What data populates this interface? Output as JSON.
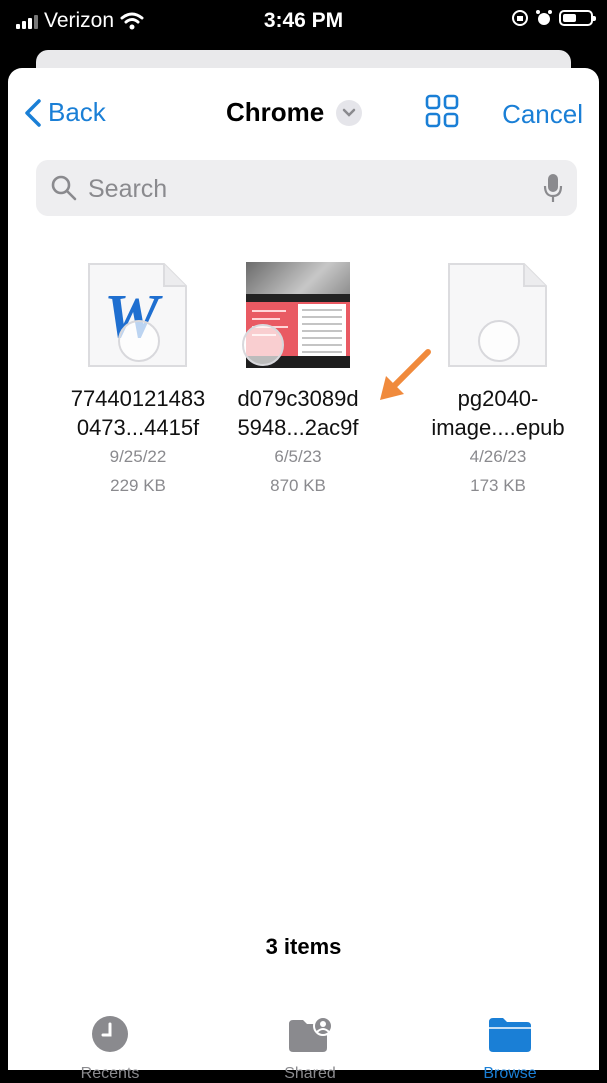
{
  "status_bar": {
    "carrier": "Verizon",
    "time": "3:46 PM"
  },
  "nav": {
    "back_label": "Back",
    "title": "Chrome",
    "cancel_label": "Cancel"
  },
  "search": {
    "placeholder": "Search"
  },
  "files": [
    {
      "name_line1": "77440121483",
      "name_line2": "0473...4415f",
      "date": "9/25/22",
      "size": "229 KB",
      "icon": "word-document-icon"
    },
    {
      "name_line1": "d079c3089d",
      "name_line2": "5948...2ac9f",
      "date": "6/5/23",
      "size": "870 KB",
      "icon": "image-thumbnail"
    },
    {
      "name_line1": "pg2040-",
      "name_line2": "image....epub",
      "date": "4/26/23",
      "size": "173 KB",
      "icon": "blank-document-icon"
    }
  ],
  "item_count": "3 items",
  "tabs": [
    {
      "label": "Recents",
      "icon": "clock-icon",
      "active": false
    },
    {
      "label": "Shared",
      "icon": "shared-folder-icon",
      "active": false
    },
    {
      "label": "Browse",
      "icon": "folder-icon",
      "active": true
    }
  ],
  "colors": {
    "accent": "#1a7fd6",
    "annotation_arrow": "#f08a3c",
    "secondary_text": "#8a8a8e"
  }
}
